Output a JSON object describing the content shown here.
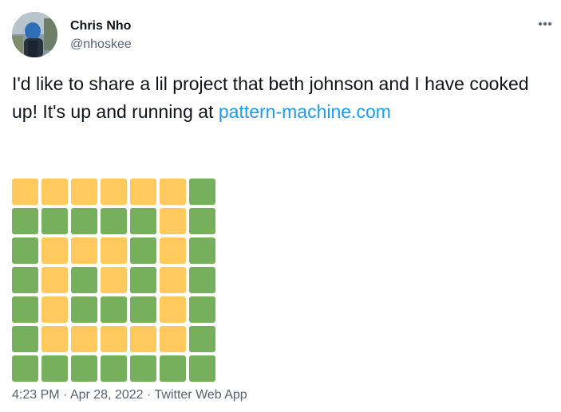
{
  "user": {
    "display_name": "Chris Nho",
    "handle": "@nhoskee"
  },
  "more_menu": {
    "icon": "more-horizontal-icon"
  },
  "tweet": {
    "text_before_link": "I'd like to share a lil project that beth johnson and I have cooked up! It's up and running at ",
    "link_text": "pattern-machine.com"
  },
  "pattern_grid": {
    "colors": {
      "Y": "#ffc95e",
      "G": "#77b05c"
    },
    "rows": [
      [
        "Y",
        "Y",
        "Y",
        "Y",
        "Y",
        "Y",
        "G"
      ],
      [
        "G",
        "G",
        "G",
        "G",
        "G",
        "Y",
        "G"
      ],
      [
        "G",
        "Y",
        "Y",
        "Y",
        "G",
        "Y",
        "G"
      ],
      [
        "G",
        "Y",
        "G",
        "Y",
        "G",
        "Y",
        "G"
      ],
      [
        "G",
        "Y",
        "G",
        "G",
        "G",
        "Y",
        "G"
      ],
      [
        "G",
        "Y",
        "Y",
        "Y",
        "Y",
        "Y",
        "G"
      ],
      [
        "G",
        "G",
        "G",
        "G",
        "G",
        "G",
        "G"
      ]
    ]
  },
  "meta": {
    "time": "4:23 PM",
    "sep1": " · ",
    "date": "Apr 28, 2022",
    "sep2": " · ",
    "source": "Twitter Web App"
  }
}
